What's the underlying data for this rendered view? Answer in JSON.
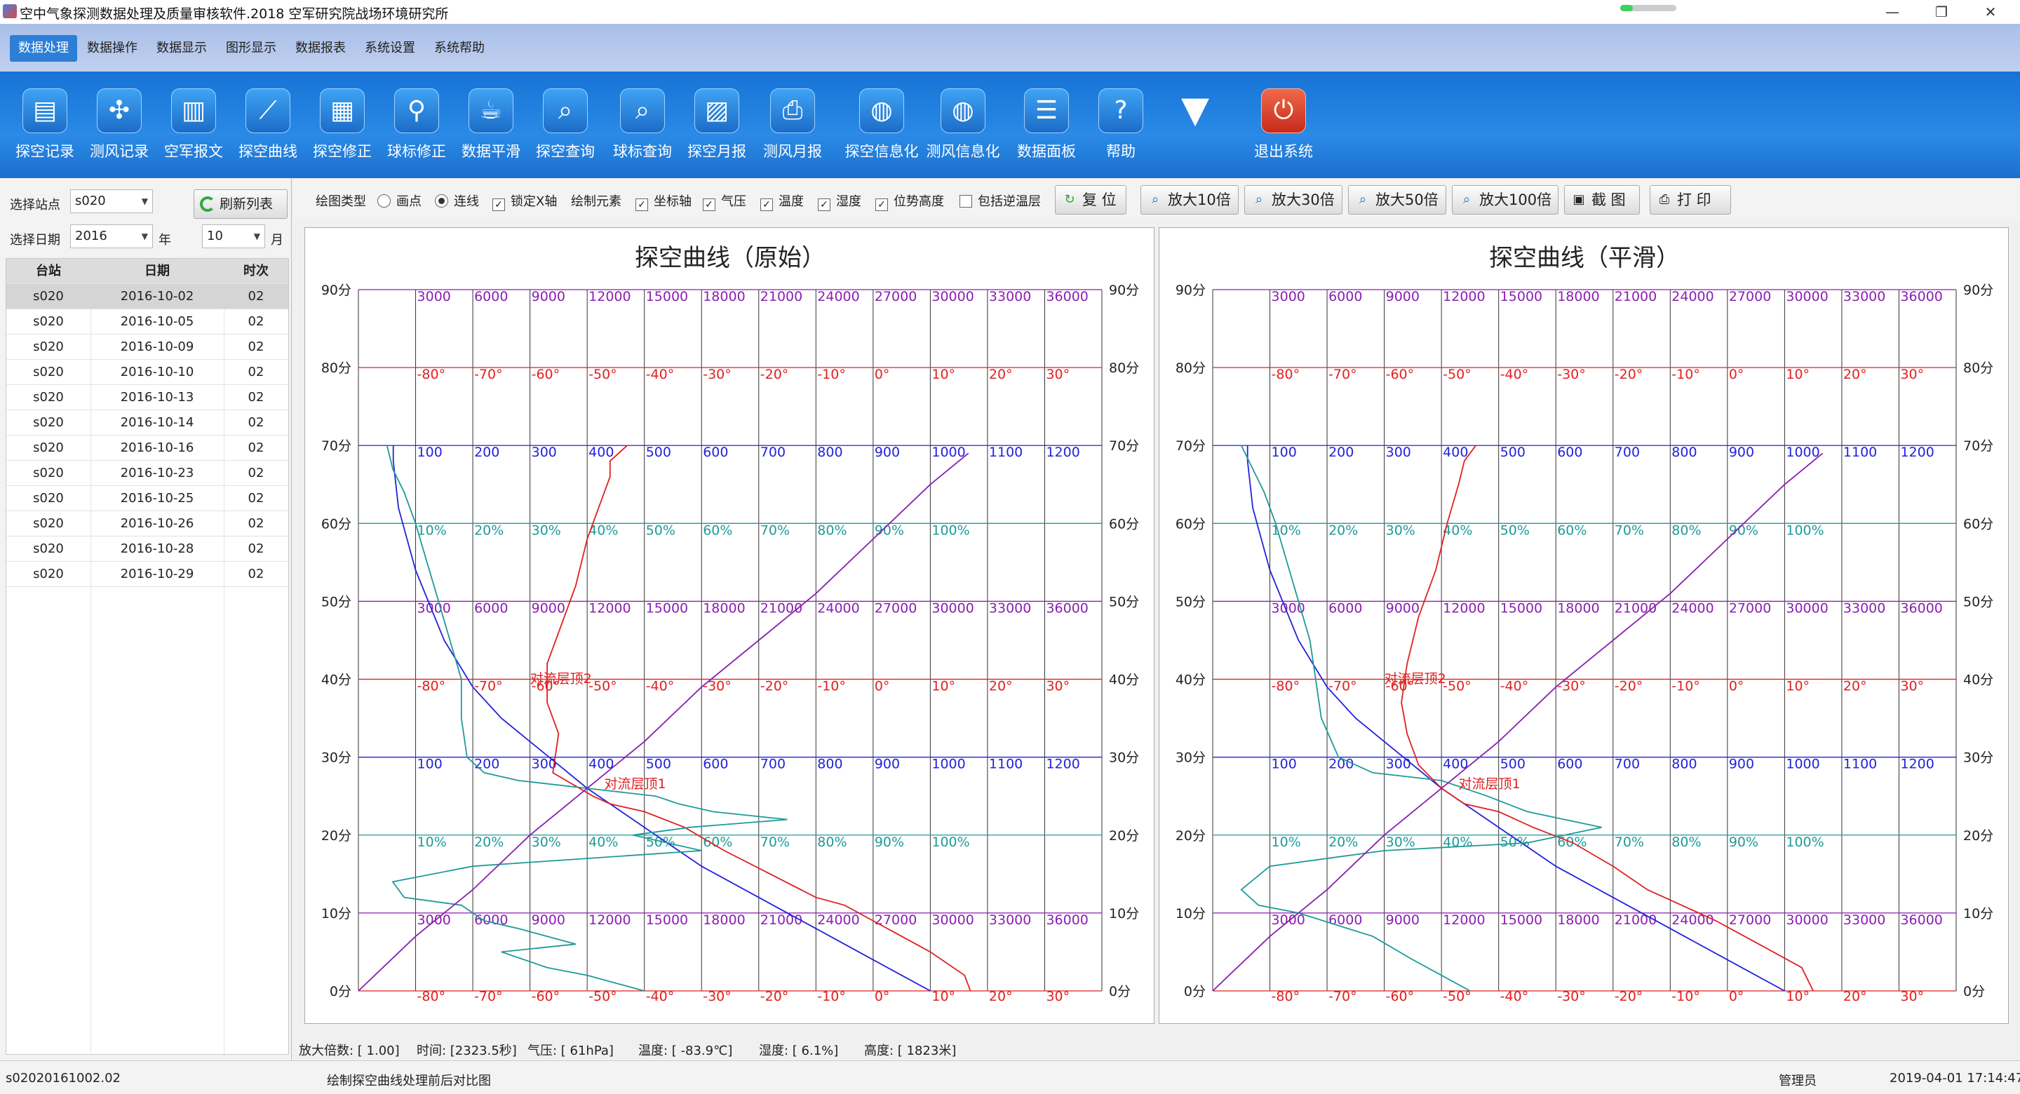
{
  "window": {
    "title": "空中气象探测数据处理及质量审核软件.2018  空军研究院战场环境研究所",
    "buttons": [
      "—",
      "❐",
      "✕"
    ]
  },
  "menu": [
    "数据处理",
    "数据操作",
    "数据显示",
    "图形显示",
    "数据报表",
    "系统设置",
    "系统帮助"
  ],
  "toolbar": [
    {
      "label": "探空记录",
      "icon": "clipboard-icon"
    },
    {
      "label": "测风记录",
      "icon": "fan-icon"
    },
    {
      "label": "空军报文",
      "icon": "document-icon"
    },
    {
      "label": "探空曲线",
      "icon": "line-chart-icon"
    },
    {
      "label": "探空修正",
      "icon": "grid-chart-icon"
    },
    {
      "label": "球标修正",
      "icon": "balloon-pin-icon"
    },
    {
      "label": "数据平滑",
      "icon": "cup-icon"
    },
    {
      "label": "探空查询",
      "icon": "cloud-search-icon"
    },
    {
      "label": "球标查询",
      "icon": "balloon-search-icon"
    },
    {
      "label": "探空月报",
      "icon": "report-chart-icon"
    },
    {
      "label": "测风月报",
      "icon": "printer-icon"
    },
    {
      "label": "探空信息化",
      "icon": "globe-cloud-icon"
    },
    {
      "label": "测风信息化",
      "icon": "globe-wind-icon"
    },
    {
      "label": "数据面板",
      "icon": "list-icon"
    },
    {
      "label": "帮助",
      "icon": "help-icon"
    },
    {
      "label": "",
      "icon": "dropdown-arrow-icon"
    },
    {
      "label": "退出系统",
      "icon": "power-icon"
    }
  ],
  "left": {
    "station_label": "选择站点",
    "station_value": "s020",
    "refresh_label": "刷新列表",
    "date_label": "选择日期",
    "year_value": "2016",
    "year_unit": "年",
    "month_value": "10",
    "month_unit": "月",
    "columns": [
      "台站",
      "日期",
      "时次"
    ],
    "rows": [
      [
        "s020",
        "2016-10-02",
        "02"
      ],
      [
        "s020",
        "2016-10-05",
        "02"
      ],
      [
        "s020",
        "2016-10-09",
        "02"
      ],
      [
        "s020",
        "2016-10-10",
        "02"
      ],
      [
        "s020",
        "2016-10-13",
        "02"
      ],
      [
        "s020",
        "2016-10-14",
        "02"
      ],
      [
        "s020",
        "2016-10-16",
        "02"
      ],
      [
        "s020",
        "2016-10-23",
        "02"
      ],
      [
        "s020",
        "2016-10-25",
        "02"
      ],
      [
        "s020",
        "2016-10-26",
        "02"
      ],
      [
        "s020",
        "2016-10-28",
        "02"
      ],
      [
        "s020",
        "2016-10-29",
        "02"
      ]
    ]
  },
  "controls": {
    "draw_type_label": "绘图类型",
    "opt_point": "画点",
    "opt_line": "连线",
    "lock_x": "锁定X轴",
    "draw_elements": "绘制元素",
    "axis": "坐标轴",
    "pressure": "气压",
    "temperature": "温度",
    "humidity": "湿度",
    "geo_height": "位势高度",
    "inversion": "包括逆温层",
    "buttons": [
      {
        "label": "复 位",
        "icon": "reset-icon"
      },
      {
        "label": "放大10倍",
        "icon": "zoom-icon"
      },
      {
        "label": "放大30倍",
        "icon": "zoom-icon"
      },
      {
        "label": "放大50倍",
        "icon": "zoom-icon"
      },
      {
        "label": "放大100倍",
        "icon": "zoom-icon"
      },
      {
        "label": "截 图",
        "icon": "save-icon"
      },
      {
        "label": "打 印",
        "icon": "print-icon"
      }
    ]
  },
  "colors": {
    "pressure": "#2222dd",
    "temperature": "#e02020",
    "humidity": "#1e9a9a",
    "geo_height": "#8a1fb0",
    "axis_line": "#333333"
  },
  "chart_data": [
    {
      "type": "line",
      "title": "探空曲线（原始）",
      "ylabel_ticks": [
        "0分",
        "10分",
        "20分",
        "30分",
        "40分",
        "50分",
        "60分",
        "70分",
        "80分",
        "90分"
      ],
      "ylim": [
        0,
        90
      ],
      "grid": true,
      "height_ticks": [
        "3000",
        "6000",
        "9000",
        "12000",
        "15000",
        "18000",
        "21000",
        "24000",
        "27000",
        "30000",
        "33000",
        "36000"
      ],
      "temp_ticks": [
        "-80°",
        "-70°",
        "-60°",
        "-50°",
        "-40°",
        "-30°",
        "-20°",
        "-10°",
        "0°",
        "10°",
        "20°",
        "30°"
      ],
      "pressure_ticks": [
        "100",
        "200",
        "300",
        "400",
        "500",
        "600",
        "700",
        "800",
        "900",
        "1000",
        "1100",
        "1200"
      ],
      "humidity_ticks": [
        "10%",
        "20%",
        "30%",
        "40%",
        "50%",
        "60%",
        "70%",
        "80%",
        "90%",
        "100%"
      ],
      "annotations": [
        "对流层顶1",
        "对流层顶2"
      ],
      "series": [
        {
          "name": "气压",
          "x": [
            1000,
            900,
            800,
            700,
            600,
            500,
            400,
            300,
            250,
            200,
            150,
            100,
            70,
            61,
            61
          ],
          "y": [
            0,
            4,
            8,
            12,
            16,
            21,
            26,
            32,
            35,
            39,
            45,
            54,
            62,
            68,
            70
          ]
        },
        {
          "name": "温度",
          "x": [
            17,
            16,
            10,
            5,
            0,
            -5,
            -10,
            -18,
            -26,
            -33,
            -40,
            -46,
            -49,
            -56,
            -55,
            -57,
            -57,
            -55,
            -52,
            -50,
            -48,
            -46,
            -46,
            -43
          ],
          "y": [
            0,
            2,
            5,
            7,
            9,
            11,
            12,
            15,
            18,
            21,
            23,
            24,
            25,
            28,
            33,
            37,
            42,
            46,
            52,
            58,
            62,
            66,
            68,
            70
          ]
        },
        {
          "name": "湿度",
          "x": [
            50,
            40,
            33,
            25,
            38,
            28,
            22,
            18,
            8,
            6,
            20,
            60,
            48,
            58,
            75,
            62,
            56,
            52,
            40,
            28,
            22,
            19,
            18,
            18,
            16,
            14,
            12,
            10,
            8,
            6,
            5
          ],
          "y": [
            0,
            2,
            3,
            5,
            6,
            8,
            9,
            11,
            12,
            14,
            16,
            18,
            20,
            21,
            22,
            23,
            24,
            25,
            26,
            27,
            28,
            30,
            35,
            40,
            45,
            50,
            55,
            60,
            64,
            67,
            70
          ]
        },
        {
          "name": "位势高度",
          "x": [
            0,
            3000,
            6000,
            9000,
            12000,
            15000,
            18000,
            21000,
            24000,
            27000,
            30000,
            32000
          ],
          "y": [
            0,
            7,
            13,
            20,
            26,
            32,
            39,
            45,
            51,
            58,
            65,
            69
          ]
        }
      ]
    },
    {
      "type": "line",
      "title": "探空曲线（平滑）",
      "ylabel_ticks": [
        "0分",
        "10分",
        "20分",
        "30分",
        "40分",
        "50分",
        "60分",
        "70分",
        "80分",
        "90分"
      ],
      "ylim": [
        0,
        90
      ],
      "grid": true,
      "height_ticks": [
        "3000",
        "6000",
        "9000",
        "12000",
        "15000",
        "18000",
        "21000",
        "24000",
        "27000",
        "30000",
        "33000",
        "36000"
      ],
      "temp_ticks": [
        "-80°",
        "-70°",
        "-60°",
        "-50°",
        "-40°",
        "-30°",
        "-20°",
        "-10°",
        "0°",
        "10°",
        "20°",
        "30°"
      ],
      "pressure_ticks": [
        "100",
        "200",
        "300",
        "400",
        "500",
        "600",
        "700",
        "800",
        "900",
        "1000",
        "1100",
        "1200"
      ],
      "humidity_ticks": [
        "10%",
        "20%",
        "30%",
        "40%",
        "50%",
        "60%",
        "70%",
        "80%",
        "90%",
        "100%"
      ],
      "annotations": [
        "对流层顶1",
        "对流层顶2"
      ],
      "series": [
        {
          "name": "气压",
          "x": [
            1000,
            900,
            800,
            700,
            600,
            500,
            400,
            300,
            250,
            200,
            150,
            100,
            70,
            61,
            61
          ],
          "y": [
            0,
            4,
            8,
            12,
            16,
            21,
            26,
            32,
            35,
            39,
            45,
            54,
            62,
            68,
            70
          ]
        },
        {
          "name": "温度",
          "x": [
            15,
            13,
            8,
            3,
            -2,
            -8,
            -14,
            -20,
            -27,
            -34,
            -40,
            -46,
            -50,
            -54,
            -56,
            -57,
            -56,
            -54,
            -51,
            -49,
            -47,
            -46,
            -44
          ],
          "y": [
            0,
            3,
            5,
            7,
            9,
            11,
            13,
            16,
            19,
            21,
            23,
            24,
            26,
            29,
            33,
            37,
            42,
            48,
            54,
            60,
            65,
            68,
            70
          ]
        },
        {
          "name": "湿度",
          "x": [
            45,
            40,
            35,
            28,
            15,
            8,
            5,
            10,
            30,
            55,
            68,
            55,
            48,
            40,
            28,
            22,
            19,
            18,
            17,
            15,
            13,
            11,
            9,
            7,
            5
          ],
          "y": [
            0,
            2,
            4,
            7,
            10,
            11,
            13,
            16,
            18,
            19,
            21,
            23,
            25,
            27,
            28,
            30,
            35,
            40,
            45,
            50,
            55,
            60,
            64,
            67,
            70
          ]
        },
        {
          "name": "位势高度",
          "x": [
            0,
            3000,
            6000,
            9000,
            12000,
            15000,
            18000,
            21000,
            24000,
            27000,
            30000,
            32000
          ],
          "y": [
            0,
            7,
            13,
            20,
            26,
            32,
            39,
            45,
            51,
            58,
            65,
            69
          ]
        }
      ]
    }
  ],
  "status": {
    "zoom": "放大倍数:  [  1.00]",
    "time": "时间: [2323.5秒]",
    "pressure": "气压: [      61hPa]",
    "temperature": "温度: [ -83.9℃]",
    "humidity": "湿度: [    6.1%]",
    "height": "高度: [  1823米]"
  },
  "bottom": {
    "record": "s02020161002.02",
    "message": "绘制探空曲线处理前后对比图",
    "user": "管理员",
    "datetime": "2019-04-01 17:14:47"
  }
}
